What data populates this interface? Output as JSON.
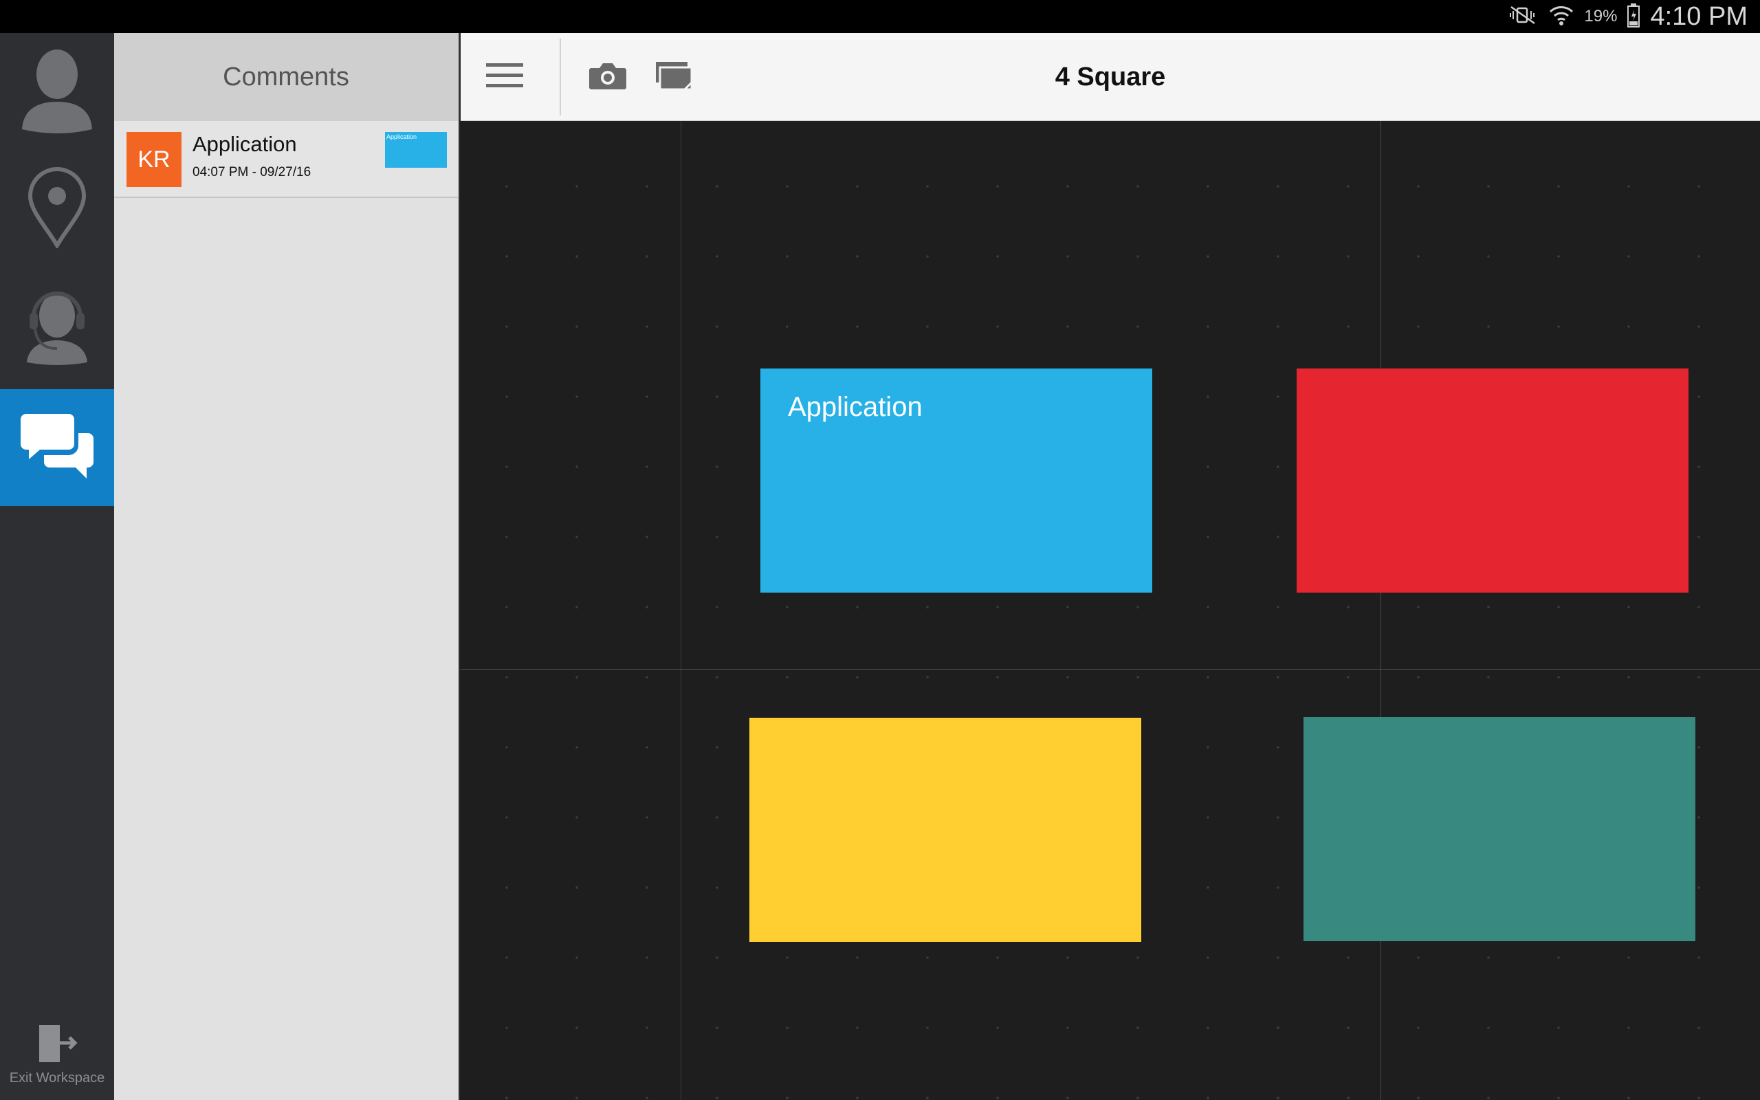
{
  "status_bar": {
    "battery_percent": "19%",
    "time": "4:10 PM",
    "icons": [
      "vibrate-mute-icon",
      "wifi-icon",
      "battery-icon"
    ]
  },
  "rail": {
    "items": [
      {
        "name": "profile",
        "icon": "person-icon",
        "active": false
      },
      {
        "name": "location",
        "icon": "map-pin-icon",
        "active": false
      },
      {
        "name": "support",
        "icon": "headset-icon",
        "active": false
      },
      {
        "name": "comments",
        "icon": "chat-bubbles-icon",
        "active": true
      }
    ],
    "exit_label": "Exit Workspace"
  },
  "comments_panel": {
    "title": "Comments",
    "items": [
      {
        "initials": "KR",
        "title": "Application",
        "timestamp": "04:07 PM - 09/27/16",
        "thumbnail_label": "Application",
        "avatar_color": "#f26522",
        "thumbnail_color": "#27b1e6"
      }
    ]
  },
  "toolbar": {
    "title": "4 Square",
    "buttons": [
      "menu-icon",
      "camera-icon",
      "cards-stack-icon"
    ]
  },
  "canvas": {
    "cards": [
      {
        "label": "Application",
        "color": "#27b1e6"
      },
      {
        "label": "",
        "color": "#e52630"
      },
      {
        "label": "",
        "color": "#ffcf31"
      },
      {
        "label": "",
        "color": "#388a80"
      }
    ]
  },
  "colors": {
    "accent": "#1280c6",
    "rail_bg": "#2d2f32",
    "canvas_bg": "#1e1e1f"
  }
}
